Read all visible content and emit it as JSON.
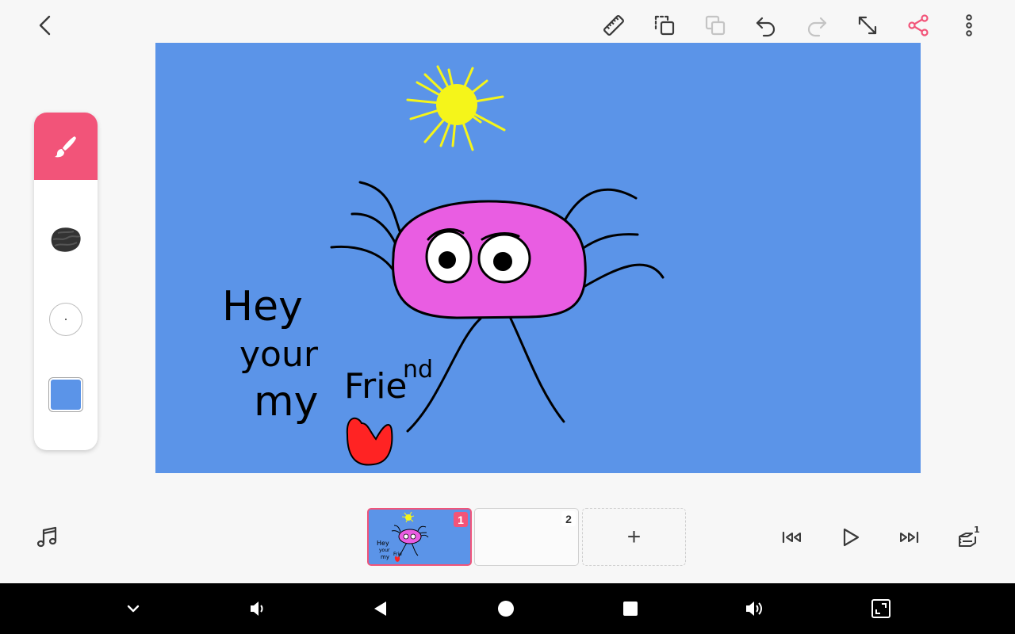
{
  "top_bar": {
    "back_icon": "chevron-left-icon",
    "tools": [
      {
        "name": "ruler-icon"
      },
      {
        "name": "copy-frame-icon"
      },
      {
        "name": "paste-frame-icon",
        "disabled": true
      },
      {
        "name": "undo-icon"
      },
      {
        "name": "redo-icon",
        "disabled": true
      },
      {
        "name": "expand-icon"
      },
      {
        "name": "share-icon",
        "accent": true
      },
      {
        "name": "more-vert-icon"
      }
    ]
  },
  "canvas": {
    "background_color": "#5b94e8",
    "handwriting": [
      "Hey",
      "your",
      "my",
      "Frie",
      "nd"
    ]
  },
  "tool_panel": {
    "active_tool": "brush-icon",
    "texture": "charcoal-brush-icon",
    "selected_color": "#5b94e8"
  },
  "frames": [
    {
      "number": "1",
      "selected": true,
      "thumbnail_text": [
        "Hey",
        "your",
        "my",
        "Frie"
      ]
    },
    {
      "number": "2",
      "selected": false
    }
  ],
  "add_frame_label": "+",
  "playback": [
    "skip-to-start-icon",
    "play-icon",
    "skip-to-end-icon"
  ],
  "layers_badge": "1",
  "colors": {
    "accent": "#f25479",
    "background": "#f7f7f7",
    "icon": "#3a3a3a",
    "icon_disabled": "#c4c4c4"
  },
  "system_nav": [
    "chevron-down-icon",
    "volume-down-icon",
    "back-triangle-icon",
    "home-circle-icon",
    "recents-square-icon",
    "volume-up-icon",
    "screenshot-icon"
  ]
}
